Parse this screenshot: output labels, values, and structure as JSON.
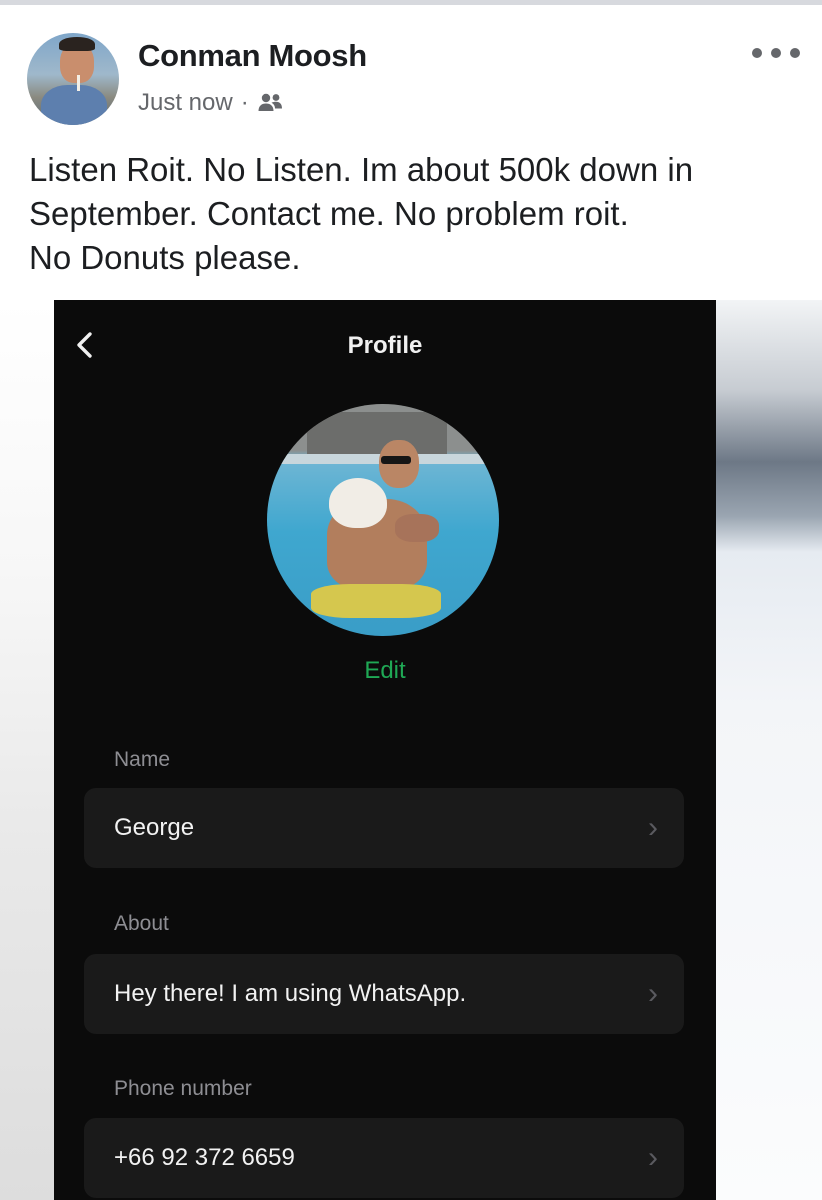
{
  "post": {
    "author": "Conman Moosh",
    "timestamp": "Just now",
    "separator": "·",
    "audience_icon": "friends-icon",
    "more_icon": "more-options-icon",
    "text_lines": [
      "Listen Roit. No Listen. Im about 500k down in",
      "September. Contact me. No problem roit.",
      "No Donuts please."
    ]
  },
  "screenshot": {
    "back_icon": "chevron-left-icon",
    "title": "Profile",
    "edit_label": "Edit",
    "fields": [
      {
        "label": "Name",
        "value": "George",
        "chevron": "›"
      },
      {
        "label": "About",
        "value": "Hey there! I am using WhatsApp.",
        "chevron": "›"
      },
      {
        "label": "Phone number",
        "value": "+66 92 372 6659",
        "chevron": "›"
      }
    ]
  },
  "colors": {
    "accent_green": "#1fa855",
    "dark_bg": "#0b0b0b",
    "row_bg": "#1a1a1a",
    "meta_gray": "#65676b"
  }
}
